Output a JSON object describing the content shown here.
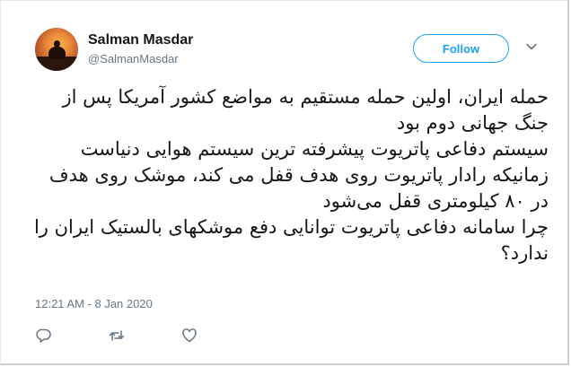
{
  "user": {
    "name": "Salman Masdar",
    "handle": "@SalmanMasdar"
  },
  "follow_label": "Follow",
  "tweet": {
    "text": "حمله ایران، اولین حمله مستقیم به مواضع کشور آمریکا پس از جنگ جهانی دوم بود\nسیستم دفاعی پاتریوت پیشرفته ترین سیستم هوایی دنیاست زمانیکه رادار پاتریوت روی هدف قفل می کند، موشک روی هدف در ۸۰ کیلومتری قفل می‌شود\nچرا سامانه دفاعی پاتریوت توانایی دفع موشکهای بالستیک ایران را ندارد؟",
    "timestamp": "12:21 AM - 8 Jan 2020"
  },
  "icons": {
    "reply": "reply-icon",
    "retweet": "retweet-icon",
    "like": "heart-icon",
    "more": "chevron-down-icon"
  },
  "colors": {
    "accent": "#1da1f2",
    "text": "#14171a",
    "muted": "#657786"
  }
}
